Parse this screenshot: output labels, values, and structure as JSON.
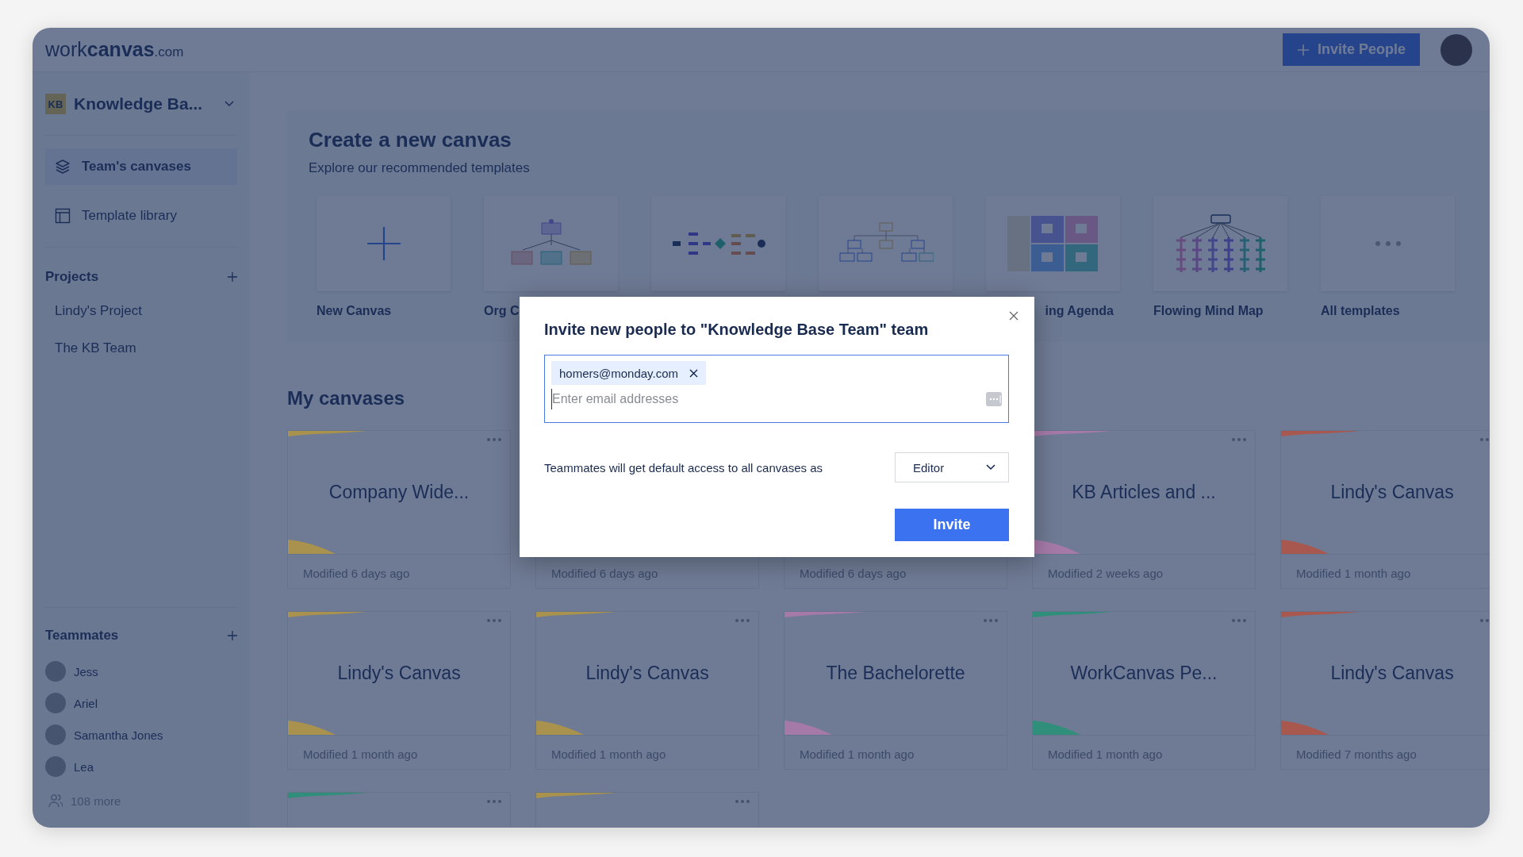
{
  "header": {
    "logo": {
      "prefix": "work",
      "brand": "canvas",
      "suffix": ".com"
    },
    "invite_button": "Invite People"
  },
  "workspace": {
    "badge": "KB",
    "name": "Knowledge Ba..."
  },
  "nav": [
    {
      "label": "Team's canvases",
      "selected": true
    },
    {
      "label": "Template library",
      "selected": false
    }
  ],
  "projects": {
    "title": "Projects",
    "items": [
      "Lindy's Project",
      "The KB Team"
    ]
  },
  "teammates": {
    "title": "Teammates",
    "members": [
      "Jess",
      "Ariel",
      "Samantha Jones",
      "Lea"
    ],
    "more": "108 more"
  },
  "templates_section": {
    "title": "Create a new canvas",
    "subtitle": "Explore our recommended templates",
    "templates": [
      {
        "kind": "new",
        "label": "New Canvas"
      },
      {
        "kind": "org",
        "label": "Org C"
      },
      {
        "kind": "flow"
      },
      {
        "kind": "tree"
      },
      {
        "kind": "grid",
        "label": "ing Agenda"
      },
      {
        "kind": "mindmap",
        "label": "Flowing Mind Map"
      },
      {
        "kind": "more",
        "label": "All templates"
      }
    ]
  },
  "my_canvases": {
    "title": "My canvases",
    "cards": [
      {
        "title": "Company Wide...",
        "modified": "Modified 6 days ago",
        "color": "#a8924e"
      },
      {
        "modified": "Modified 6 days ago"
      },
      {
        "modified": "Modified 6 days ago"
      },
      {
        "title": "KB Articles and ...",
        "modified": "Modified 2 weeks ago",
        "color": "#a67aa8"
      },
      {
        "title": "Lindy's Canvas",
        "modified": "Modified 1 month ago",
        "color": "#a8584f"
      },
      {
        "title": "Lindy's Canvas",
        "modified": "Modified 1 month ago",
        "color": "#a8924e"
      },
      {
        "title": "Lindy's Canvas",
        "modified": "Modified 1 month ago",
        "color": "#a8924e"
      },
      {
        "title": "The Bachelorette",
        "modified": "Modified 1 month ago",
        "color": "#a67aa8"
      },
      {
        "title": "WorkCanvas Pe...",
        "modified": "Modified 1 month ago",
        "color": "#2f8f7a"
      },
      {
        "title": "Lindy's Canvas",
        "modified": "Modified 7 months ago",
        "color": "#a8584f"
      },
      {
        "color": "#2f8f7a"
      },
      {
        "color": "#a8924e"
      }
    ]
  },
  "invite_dialog": {
    "title": "Invite new people to \"Knowledge Base Team\" team",
    "chips": [
      "homers@monday.com"
    ],
    "placeholder": "Enter email addresses",
    "access_text": "Teammates will get default access to all canvases as",
    "role": "Editor",
    "submit": "Invite"
  }
}
